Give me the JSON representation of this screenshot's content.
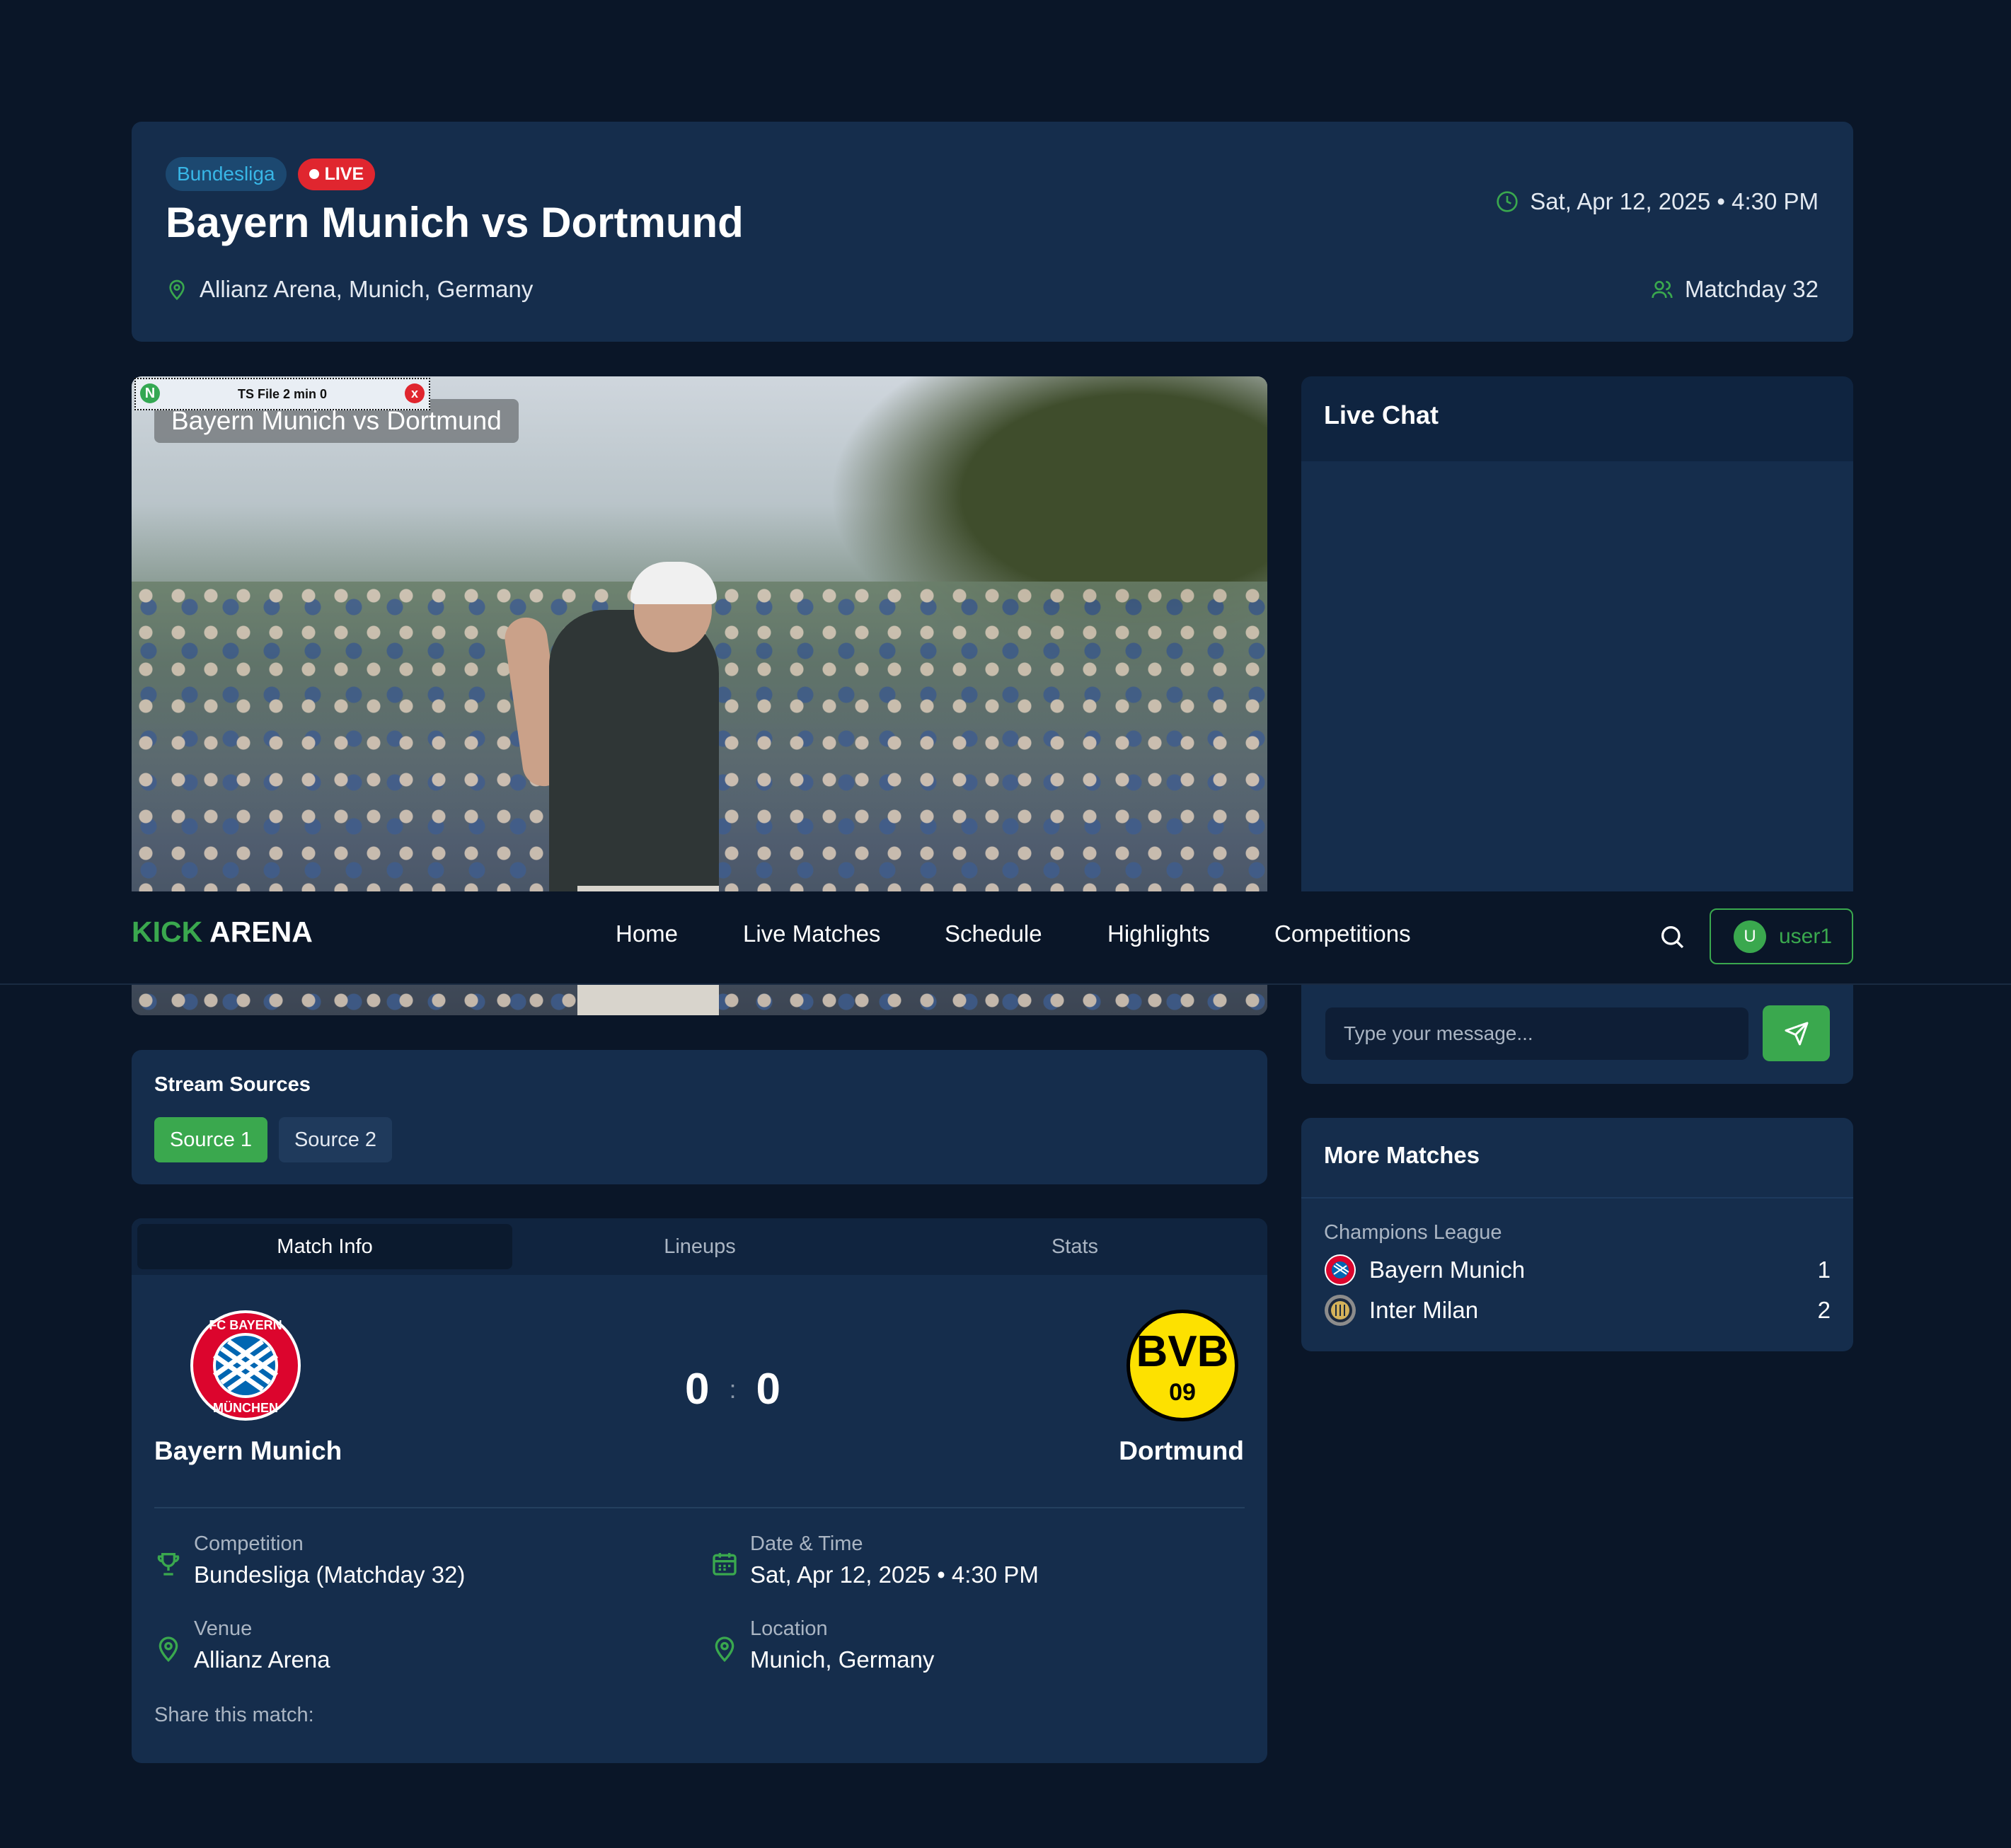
{
  "header": {
    "league_badge": "Bundesliga",
    "live_badge": "LIVE",
    "title": "Bayern Munich vs Dortmund",
    "datetime": "Sat, Apr 12, 2025 • 4:30 PM",
    "venue": "Allianz Arena, Munich, Germany",
    "matchday": "Matchday 32"
  },
  "player": {
    "overlay_title": "Bayern Munich vs Dortmund",
    "ts_label": "TS File 2 min 0",
    "ts_left_icon": "N",
    "ts_close_icon": "x"
  },
  "chat": {
    "title": "Live Chat",
    "input_placeholder": "Type your message..."
  },
  "navbar": {
    "brand_left": "KICK",
    "brand_right": "ARENA",
    "items": [
      "Home",
      "Live Matches",
      "Schedule",
      "Highlights",
      "Competitions"
    ],
    "user_initial": "U",
    "username": "user1"
  },
  "stream_sources": {
    "title": "Stream Sources",
    "sources": [
      "Source 1",
      "Source 2"
    ],
    "active": "Source 1"
  },
  "tabs": {
    "items": [
      "Match Info",
      "Lineups",
      "Stats"
    ],
    "active": "Match Info"
  },
  "match": {
    "home_team": "Bayern Munich",
    "away_team": "Dortmund",
    "home_score": "0",
    "away_score": "0",
    "separator": ":",
    "away_logo_top": "BVB",
    "away_logo_bottom": "09",
    "home_logo_ring": "FC BAYERN MÜNCHEN"
  },
  "info": {
    "competition_label": "Competition",
    "competition_value": "Bundesliga (Matchday 32)",
    "datetime_label": "Date & Time",
    "datetime_value": "Sat, Apr 12, 2025 • 4:30 PM",
    "venue_label": "Venue",
    "venue_value": "Allianz Arena",
    "location_label": "Location",
    "location_value": "Munich, Germany",
    "share_label": "Share this match:"
  },
  "more_matches": {
    "title": "More Matches",
    "competition": "Champions League",
    "teams": [
      {
        "name": "Bayern Munich",
        "score": "1"
      },
      {
        "name": "Inter Milan",
        "score": "2"
      }
    ]
  },
  "colors": {
    "background": "#0a1628",
    "card": "#152d4c",
    "accent_green": "#3aa84e",
    "live_red": "#e0262f",
    "league_blue": "#38b6e6"
  },
  "icons": [
    "clock-icon",
    "map-pin-icon",
    "users-icon",
    "search-icon",
    "send-icon",
    "trophy-icon",
    "calendar-icon"
  ]
}
